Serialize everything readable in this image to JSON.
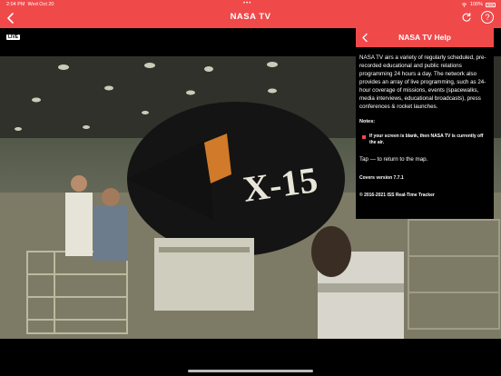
{
  "status_bar": {
    "time": "2:04 PM",
    "date": "Wed Oct 20",
    "battery": "100%"
  },
  "header": {
    "title": "NASA TV",
    "back_icon": "chevron-left-icon",
    "refresh_icon": "refresh-icon",
    "help_icon": "question-circle-icon",
    "help_label": "?"
  },
  "video": {
    "live_label": "LIVE",
    "aircraft_marking": "X-15"
  },
  "help_panel": {
    "title": "NASA TV Help",
    "intro": "NASA TV airs a variety of regularly scheduled, pre-recorded educational and public relations programming 24 hours a day. The network also provides an array of live programming, such as 24-hour coverage of missions, events (spacewalks, media interviews, educational broadcasts), press conferences & rocket launches.",
    "notes_label": "Notes:",
    "note": "If your screen is blank, then NASA TV is currently off the air.",
    "tap_text": "Tap — to return to the map.",
    "version": "Covers version 7.7.1",
    "copyright": "© 2016-2021 ISS Real-Time Tracker"
  },
  "colors": {
    "accent": "#f0494a",
    "background": "#000000"
  }
}
